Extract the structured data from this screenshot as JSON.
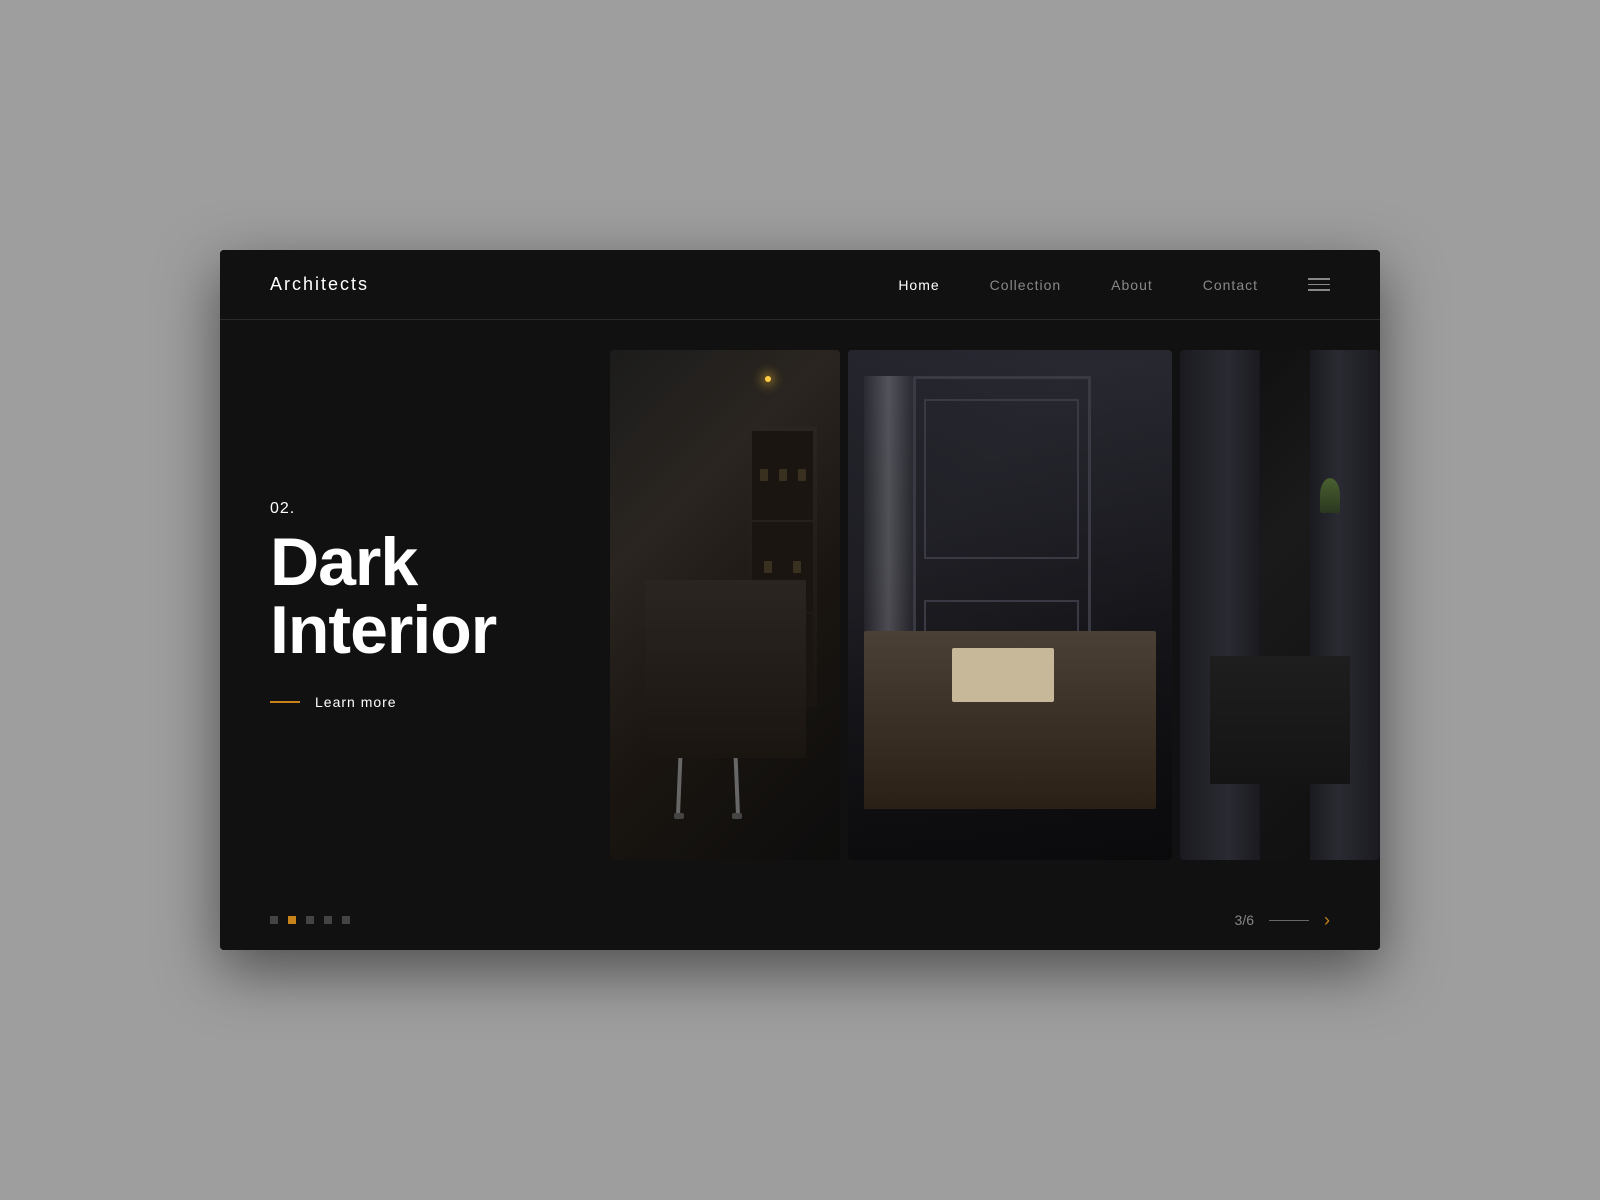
{
  "brand": {
    "name": "Architects"
  },
  "nav": {
    "links": [
      {
        "label": "Home",
        "active": true
      },
      {
        "label": "Collection",
        "active": false
      },
      {
        "label": "About",
        "active": false
      },
      {
        "label": "Contact",
        "active": false
      }
    ]
  },
  "slide": {
    "number": "02.",
    "title_line1": "Dark",
    "title_line2": "Interior",
    "learn_more": "Learn more"
  },
  "pagination": {
    "counter": "3/6",
    "dots": [
      {
        "active": false
      },
      {
        "active": true
      },
      {
        "active": false
      },
      {
        "active": false
      },
      {
        "active": false
      }
    ]
  },
  "colors": {
    "accent": "#c8821a",
    "bg": "#111111",
    "text_primary": "#ffffff",
    "text_secondary": "#888888",
    "nav_active": "#ffffff"
  }
}
